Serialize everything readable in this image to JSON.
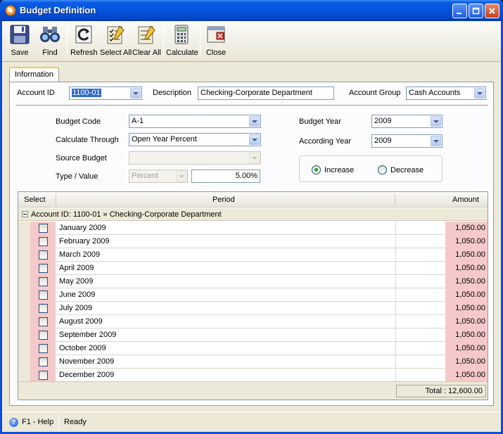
{
  "window": {
    "title": "Budget Definition"
  },
  "toolbar": {
    "save": "Save",
    "find": "Find",
    "refresh": "Refresh",
    "select_all": "Select All",
    "clear_all": "Clear All",
    "calculate": "Calculate",
    "close": "Close"
  },
  "tabs": [
    {
      "label": "Information",
      "active": true
    }
  ],
  "header": {
    "account_id_label": "Account ID",
    "account_id_value": "1100-01",
    "description_label": "Description",
    "description_value": "Checking-Corporate Department",
    "account_group_label": "Account Group",
    "account_group_value": "Cash Accounts"
  },
  "form": {
    "budget_code_label": "Budget Code",
    "budget_code_value": "A-1",
    "calculate_through_label": "Calculate Through",
    "calculate_through_value": "Open Year Percent",
    "source_budget_label": "Source Budget",
    "source_budget_value": "",
    "type_value_label": "Type / Value",
    "type_value": "Percent",
    "value_amount": "5.00%",
    "budget_year_label": "Budget Year",
    "budget_year_value": "2009",
    "according_year_label": "According Year",
    "according_year_value": "2009",
    "increase_label": "Increase",
    "decrease_label": "Decrease",
    "selected_direction": "Increase"
  },
  "grid": {
    "columns": [
      "Select",
      "Period",
      "Amount"
    ],
    "group_label": "Account ID: 1100-01 » Checking-Corporate Department",
    "rows": [
      {
        "period": "January 2009",
        "amount": "1,050.00",
        "selected": false
      },
      {
        "period": "February 2009",
        "amount": "1,050.00",
        "selected": false
      },
      {
        "period": "March 2009",
        "amount": "1,050.00",
        "selected": false
      },
      {
        "period": "April 2009",
        "amount": "1,050.00",
        "selected": false
      },
      {
        "period": "May 2009",
        "amount": "1,050.00",
        "selected": false
      },
      {
        "period": "June 2009",
        "amount": "1,050.00",
        "selected": false
      },
      {
        "period": "July 2009",
        "amount": "1,050.00",
        "selected": false
      },
      {
        "period": "August 2009",
        "amount": "1,050.00",
        "selected": false
      },
      {
        "period": "September 2009",
        "amount": "1,050.00",
        "selected": false
      },
      {
        "period": "October 2009",
        "amount": "1,050.00",
        "selected": false
      },
      {
        "period": "November 2009",
        "amount": "1,050.00",
        "selected": false
      },
      {
        "period": "December 2009",
        "amount": "1,050.00",
        "selected": false
      }
    ],
    "total": "Total : 12,600.00"
  },
  "status": {
    "help": "F1 - Help",
    "state": "Ready"
  },
  "colors": {
    "titlebar": "#0553de",
    "highlight_cell": "#f5c9c9",
    "selection": "#316ac5"
  }
}
